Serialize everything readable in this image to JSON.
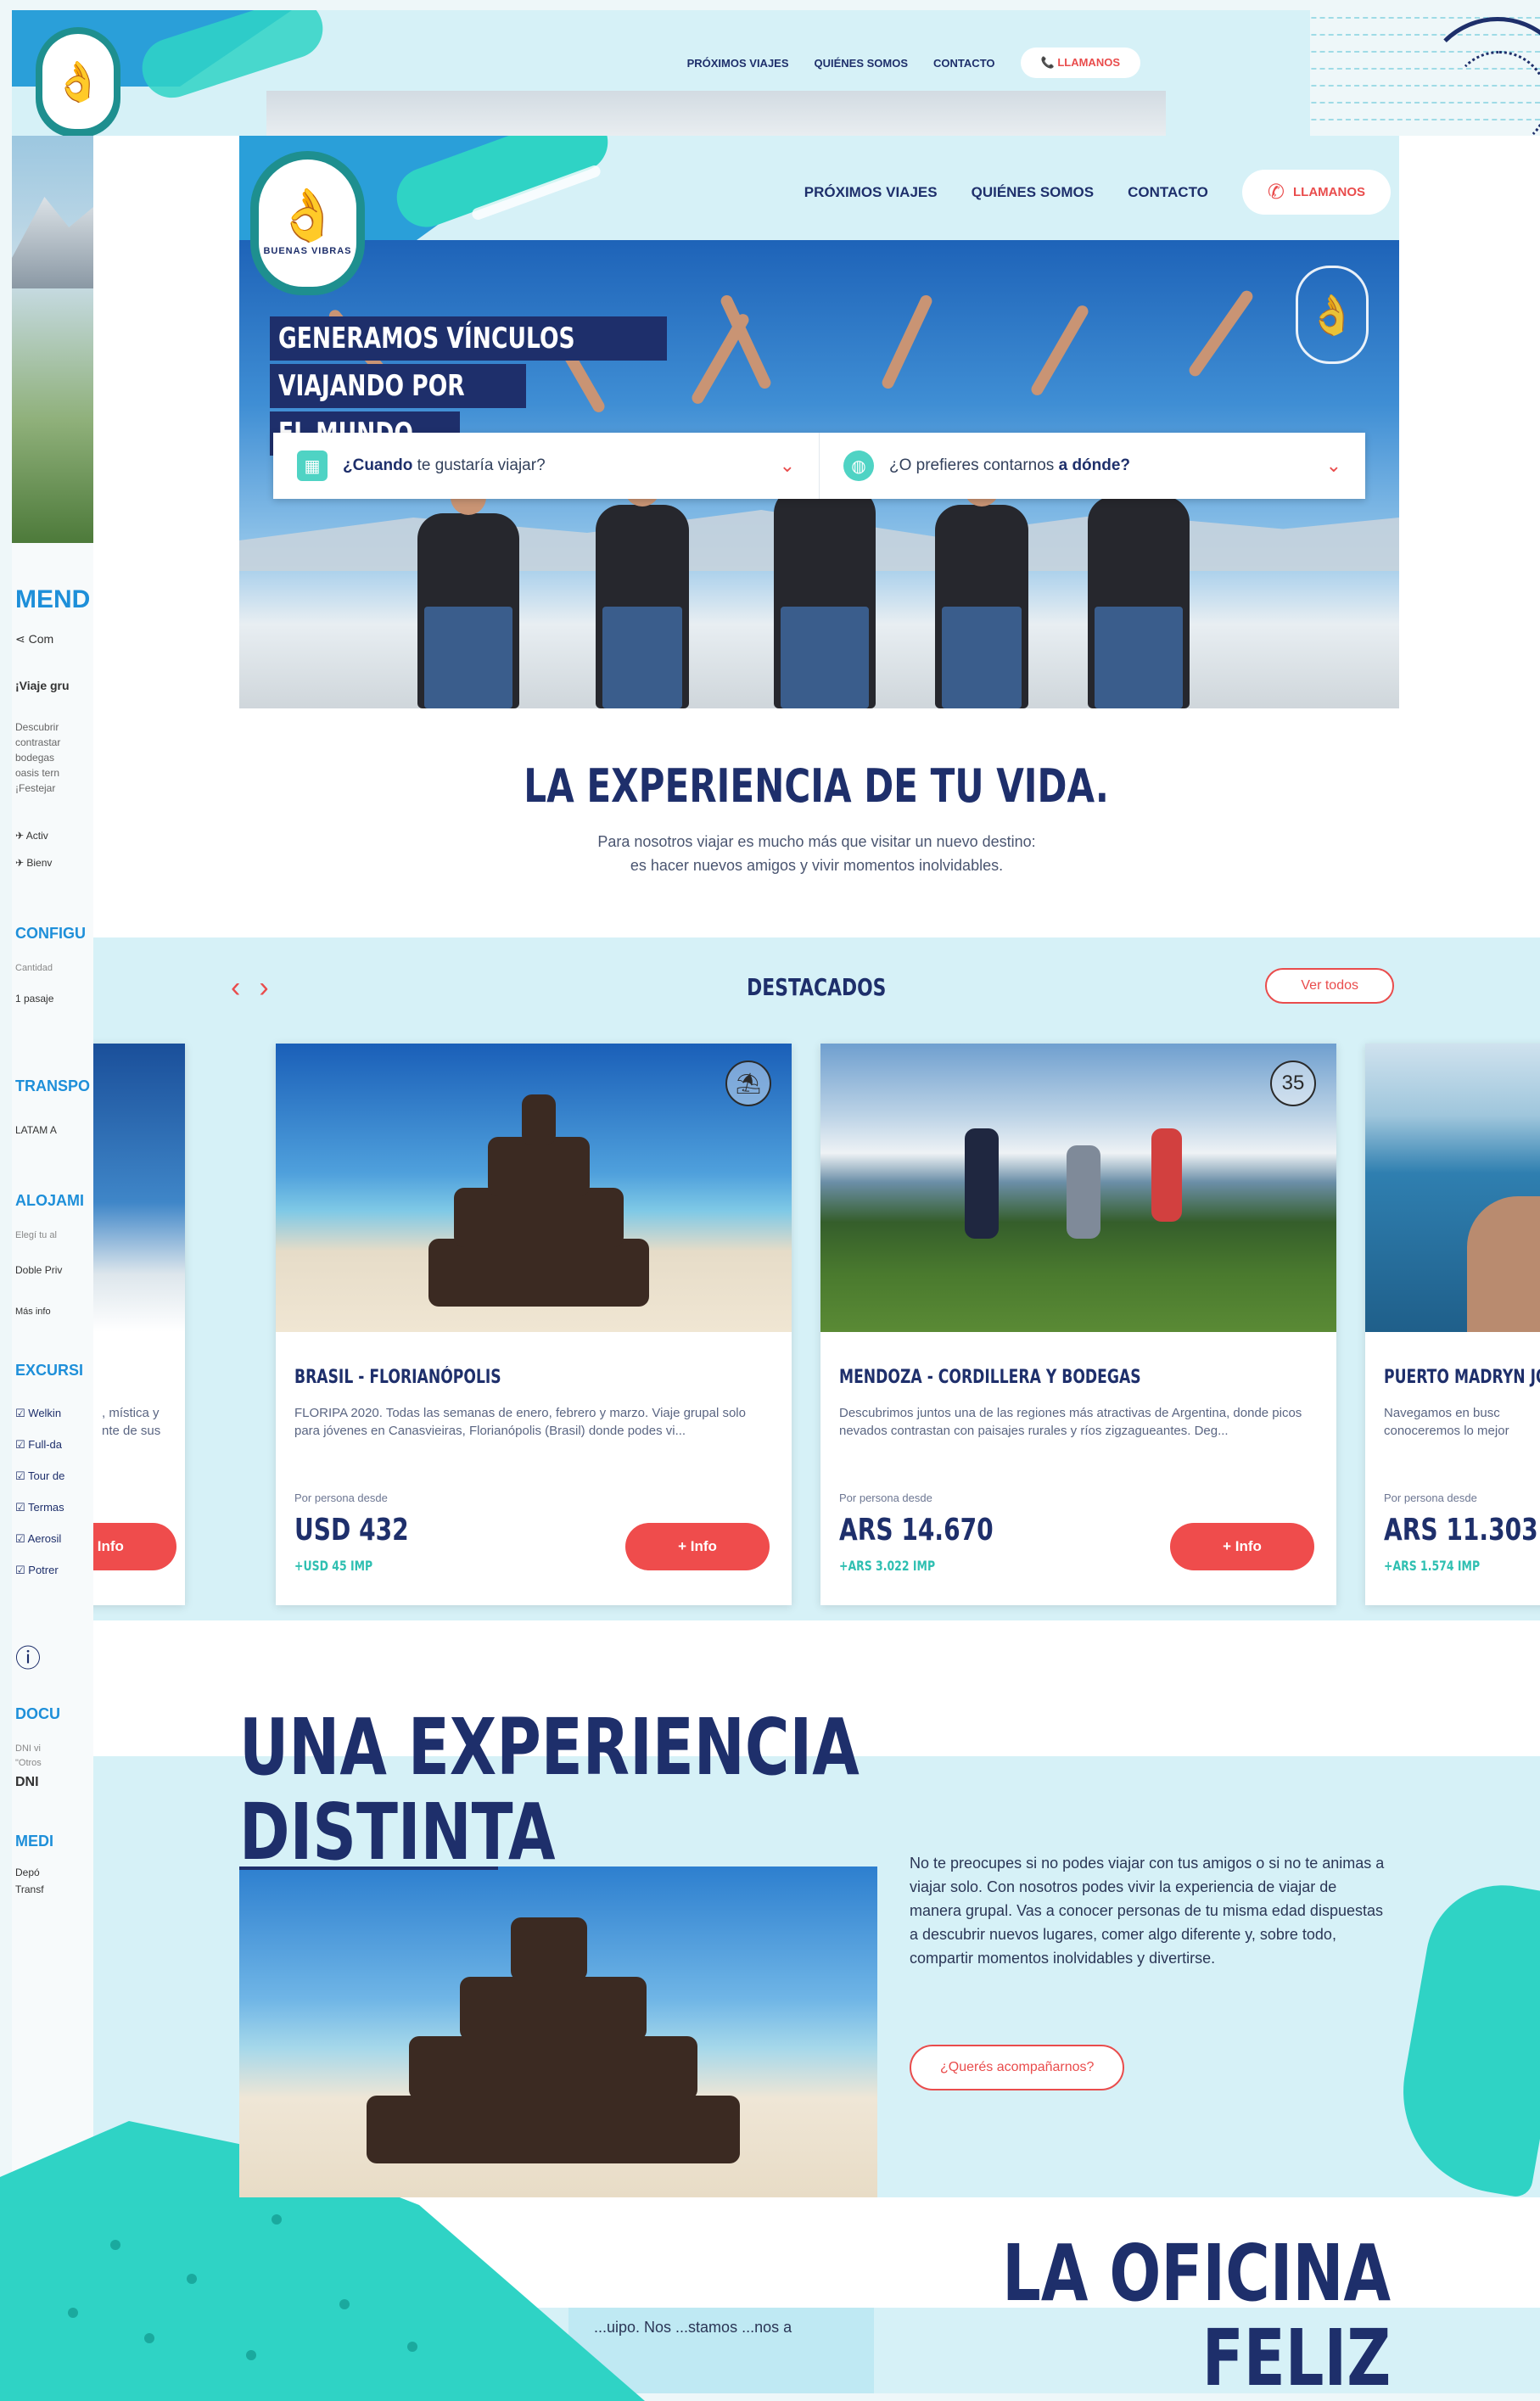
{
  "back_page": {
    "nav": [
      "PRÓXIMOS VIAJES",
      "QUIÉNES SOMOS",
      "CONTACTO"
    ],
    "call_label": "LLAMANOS"
  },
  "left_page": {
    "title": "MEND",
    "share": "Com",
    "subtitle": "¡Viaje gru",
    "desc": [
      "Descubrir",
      "contrastar",
      "bodegas",
      "oasis tern",
      "¡Festejar"
    ],
    "items": [
      "Activ",
      "Bienv"
    ],
    "h_config": "CONFIGU",
    "cantidad": "Cantidad",
    "pasajero": "1 pasaje",
    "h_transp": "TRANSPO",
    "latam": "LATAM A",
    "h_aloj": "ALOJAMI",
    "elegi": "Elegí tu al",
    "doble": "Doble Priv",
    "mas_info": "Más info",
    "h_exc": "EXCURSI",
    "excursions": [
      "Welkin",
      "Full-da",
      "Tour de",
      "Termas",
      "Aerosil",
      "Potrer"
    ],
    "h_docu": "DOCU",
    "dni_line1": "DNI vi",
    "dni_line2": "\"Otros",
    "dni": "DNI",
    "h_medi": "MEDI",
    "depo": "Depó",
    "trans": "Transf"
  },
  "header": {
    "logo_text": "BUENAS VIBRAS",
    "nav": [
      "PRÓXIMOS VIAJES",
      "QUIÉNES SOMOS",
      "CONTACTO"
    ],
    "call_label": "LLAMANOS"
  },
  "hero": {
    "title_lines": [
      "GENERAMOS VÍNCULOS",
      "VIAJANDO POR",
      "EL MUNDO"
    ],
    "search_when_bold": "¿Cuando",
    "search_when_rest": " te gustaría viajar?",
    "search_where_start": "¿O prefieres contarnos ",
    "search_where_bold": "a dónde?"
  },
  "experience": {
    "title": "LA EXPERIENCIA DE TU VIDA.",
    "subtitle_1": "Para nosotros viajar es mucho más que visitar un nuevo destino:",
    "subtitle_2": "es hacer nuevos amigos y vivir momentos inolvidables."
  },
  "destacados": {
    "title": "DESTACADOS",
    "ver_todos": "Ver todos",
    "per_person": "Por persona desde",
    "more_info": "+ Info",
    "cards": [
      {
        "title": "BRASIL - FLORIANÓPOLIS",
        "desc": "FLORIPA 2020. Todas las semanas de enero, febrero y marzo. Viaje grupal solo para jóvenes en Canasvieiras, Florianópolis (Brasil) donde podes vi...",
        "price": "USD 432",
        "imp": "+USD 45 IMP",
        "badge": "⛱"
      },
      {
        "title": "MENDOZA - CORDILLERA Y BODEGAS",
        "desc": "Descubrimos juntos una de las regiones más atractivas de Argentina, donde picos nevados contrastan con paisajes rurales y ríos zigzagueantes. Deg...",
        "price": "ARS 14.670",
        "imp": "+ARS 3.022 IMP",
        "badge": "35"
      },
      {
        "title": "PUERTO MADRYN JO",
        "desc": "Navegamos en busc conoceremos lo mejor",
        "price": "ARS 11.303",
        "imp": "+ARS 1.574 IMP"
      }
    ],
    "left_card_desc": ", mística y nte de sus"
  },
  "una_experiencia": {
    "title_1": "UNA EXPERIENCIA",
    "title_2": "DISTINTA",
    "text": "No te preocupes si no podes viajar con tus amigos o si no te animas a viajar solo. Con nosotros podes vivir la experiencia de viajar de manera grupal. Vas a conocer personas de tu misma edad dispuestas a descubrir nuevos lugares, comer algo diferente y, sobre todo, compartir momentos inolvidables y divertirse.",
    "button": "¿Querés acompañarnos?"
  },
  "oficina": {
    "title_1": "LA OFICINA",
    "title_2": "FELIZ",
    "text": "...uipo. Nos ...stamos ...nos a"
  }
}
